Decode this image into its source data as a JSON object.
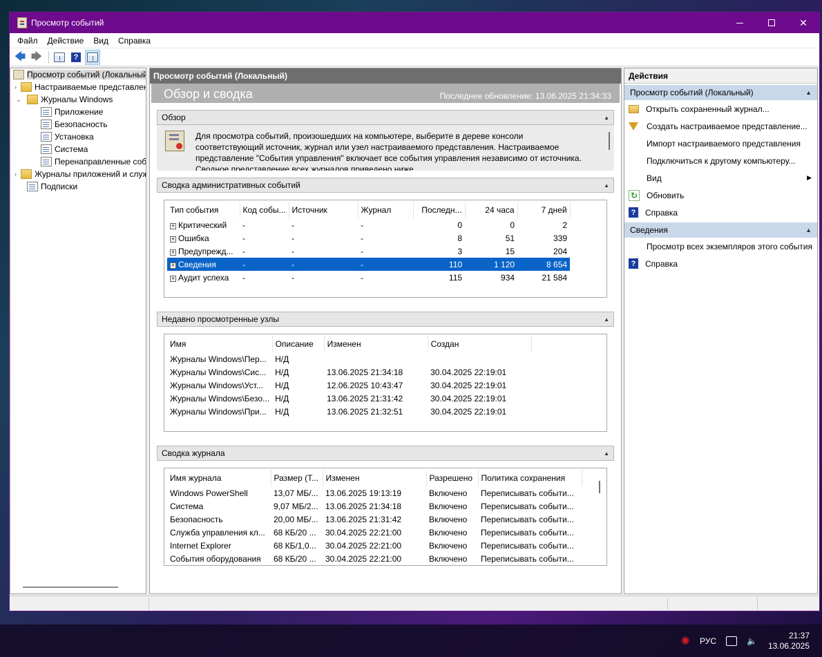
{
  "window": {
    "title": "Просмотр событий",
    "controls": {
      "minimize": "",
      "maximize": "",
      "close": "✕"
    }
  },
  "menu": [
    "Файл",
    "Действие",
    "Вид",
    "Справка"
  ],
  "toolbar": {
    "back": "🡄",
    "forward": "🡆",
    "help": "?"
  },
  "tree": {
    "root": "Просмотр событий (Локальный)",
    "items": [
      {
        "label": "Настраиваемые представления",
        "expander": "›",
        "icon": "folder-filter-icon"
      },
      {
        "label": "Журналы Windows",
        "expander": "⌄",
        "icon": "folder-icon"
      },
      {
        "label": "Приложение",
        "icon": "log-icon"
      },
      {
        "label": "Безопасность",
        "icon": "log-icon"
      },
      {
        "label": "Установка",
        "icon": "log-icon"
      },
      {
        "label": "Система",
        "icon": "log-icon"
      },
      {
        "label": "Перенаправленные события",
        "icon": "log-icon"
      },
      {
        "label": "Журналы приложений и служб",
        "expander": "›",
        "icon": "folder-icon"
      },
      {
        "label": "Подписки",
        "icon": "subscriptions-icon"
      }
    ]
  },
  "center": {
    "header": "Просмотр событий (Локальный)",
    "banner_title": "Обзор и сводка",
    "last_update": "Последнее обновление: 13.06.2025 21:34:33",
    "overview": {
      "title": "Обзор",
      "text_lines": [
        "Для просмотра событий, произошедших на компьютере, выберите в дереве консоли",
        "соответствующий источник, журнал или узел настраиваемого представления. Настраиваемое",
        "представление \"События управления\" включает все события управления независимо от источника.",
        "Сводное представление всех журналов приведено ниже."
      ]
    },
    "admin_summary": {
      "title": "Сводка административных событий",
      "columns": [
        "Тип события",
        "Код собы...",
        "Источник",
        "Журнал",
        "Последн...",
        "24 часа",
        "7 дней"
      ],
      "rows": [
        {
          "type": "Критический",
          "code": "-",
          "source": "-",
          "log": "-",
          "last": "0",
          "day": "0",
          "week": "2"
        },
        {
          "type": "Ошибка",
          "code": "-",
          "source": "-",
          "log": "-",
          "last": "8",
          "day": "51",
          "week": "339"
        },
        {
          "type": "Предупрежд...",
          "code": "-",
          "source": "-",
          "log": "-",
          "last": "3",
          "day": "15",
          "week": "204"
        },
        {
          "type": "Сведения",
          "code": "-",
          "source": "-",
          "log": "-",
          "last": "110",
          "day": "1 120",
          "week": "8 654"
        },
        {
          "type": "Аудит успеха",
          "code": "-",
          "source": "-",
          "log": "-",
          "last": "115",
          "day": "934",
          "week": "21 584"
        }
      ],
      "selected_index": 3
    },
    "recent_nodes": {
      "title": "Недавно просмотренные узлы",
      "columns": [
        "Имя",
        "Описание",
        "Изменен",
        "Создан"
      ],
      "rows": [
        {
          "name": "Журналы Windows\\Пер...",
          "desc": "Н/Д",
          "modified": "",
          "created": ""
        },
        {
          "name": "Журналы Windows\\Сис...",
          "desc": "Н/Д",
          "modified": "13.06.2025 21:34:18",
          "created": "30.04.2025 22:19:01"
        },
        {
          "name": "Журналы Windows\\Уст...",
          "desc": "Н/Д",
          "modified": "12.06.2025 10:43:47",
          "created": "30.04.2025 22:19:01"
        },
        {
          "name": "Журналы Windows\\Безо...",
          "desc": "Н/Д",
          "modified": "13.06.2025 21:31:42",
          "created": "30.04.2025 22:19:01"
        },
        {
          "name": "Журналы Windows\\При...",
          "desc": "Н/Д",
          "modified": "13.06.2025 21:32:51",
          "created": "30.04.2025 22:19:01"
        }
      ]
    },
    "log_summary": {
      "title": "Сводка журнала",
      "columns": [
        "Имя журнала",
        "Размер (Т...",
        "Изменен",
        "Разрешено",
        "Политика сохранения"
      ],
      "rows": [
        {
          "name": "Windows PowerShell",
          "size": "13,07 МБ/...",
          "modified": "13.06.2025 19:13:19",
          "enabled": "Включено",
          "policy": "Переписывать событи..."
        },
        {
          "name": "Система",
          "size": "9,07 МБ/2...",
          "modified": "13.06.2025 21:34:18",
          "enabled": "Включено",
          "policy": "Переписывать событи..."
        },
        {
          "name": "Безопасность",
          "size": "20,00 МБ/...",
          "modified": "13.06.2025 21:31:42",
          "enabled": "Включено",
          "policy": "Переписывать событи..."
        },
        {
          "name": "Служба управления кл...",
          "size": "68 КБ/20 ...",
          "modified": "30.04.2025 22:21:00",
          "enabled": "Включено",
          "policy": "Переписывать событи..."
        },
        {
          "name": "Internet Explorer",
          "size": "68 КБ/1,0...",
          "modified": "30.04.2025 22:21:00",
          "enabled": "Включено",
          "policy": "Переписывать событи..."
        },
        {
          "name": "События оборудования",
          "size": "68 КБ/20 ...",
          "modified": "30.04.2025 22:21:00",
          "enabled": "Включено",
          "policy": "Переписывать событи..."
        }
      ]
    }
  },
  "actions": {
    "header": "Действия",
    "group1": {
      "title": "Просмотр событий (Локальный)",
      "items": [
        {
          "label": "Открыть сохраненный журнал...",
          "icon": "open-folder-icon"
        },
        {
          "label": "Создать настраиваемое представление...",
          "icon": "filter-icon"
        },
        {
          "label": "Импорт настраиваемого представления",
          "icon": "none"
        },
        {
          "label": "Подключиться к другому компьютеру...",
          "icon": "none"
        },
        {
          "label": "Вид",
          "icon": "none",
          "submenu": "▶"
        },
        {
          "label": "Обновить",
          "icon": "refresh-icon"
        },
        {
          "label": "Справка",
          "icon": "help-icon"
        }
      ]
    },
    "group2": {
      "title": "Сведения",
      "items": [
        {
          "label": "Просмотр всех экземпляров этого события",
          "icon": "none"
        },
        {
          "label": "Справка",
          "icon": "help-icon"
        }
      ]
    },
    "collapse_glyph": "▲"
  },
  "taskbar": {
    "language": "РУС",
    "time": "21:37",
    "date": "13.06.2025"
  }
}
